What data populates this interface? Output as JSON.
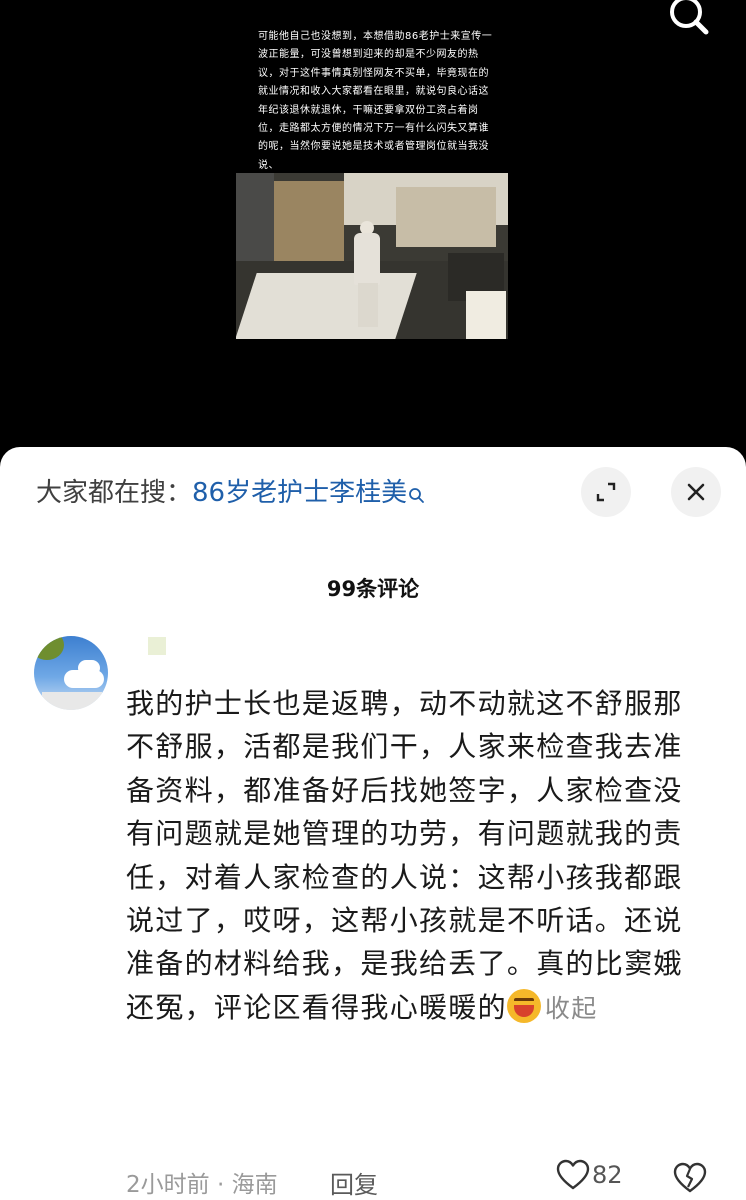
{
  "video": {
    "caption": "可能他自己也没想到，本想借助86老护士来宣传一波正能量，可没曾想到迎来的却是不少网友的热议，对于这件事情真别怪网友不买单，毕竟现在的就业情况和收入大家都看在眼里，就说句良心话这年纪该退休就退休，干嘛还要拿双份工资占着岗位，走路都太方便的情况下万一有什么闪失又算谁的呢，当然你要说她是技术或者管理岗位就当我没说、",
    "search_icon": "search-icon"
  },
  "sheet": {
    "hot_search_prefix": "大家都在搜：",
    "hot_search_term": "86岁老护士李桂美",
    "hot_search_icon": "search-icon",
    "expand_icon": "expand-icon",
    "close_icon": "close-icon",
    "comment_count": "99条评论"
  },
  "comment": {
    "text": "我的护士长也是返聘，动不动就这不舒服那不舒服，活都是我们干，人家来检查我去准备资料，都准备好后找她签字，人家检查没有问题就是她管理的功劳，有问题就我的责任，对着人家检查的人说：这帮小孩我都跟说过了，哎呀，这帮小孩就是不听话。还说准备的材料给我，是我给丢了。真的比窦娥还冤，评论区看得我心暖暖的",
    "emoji": "laughing-emoji",
    "collapse_label": "收起",
    "meta": "2小时前 · 海南",
    "reply_label": "回复",
    "like_count": "82"
  },
  "colors": {
    "link_blue": "#1f5faa",
    "background_top": "#000000",
    "sheet_bg": "#ffffff"
  }
}
